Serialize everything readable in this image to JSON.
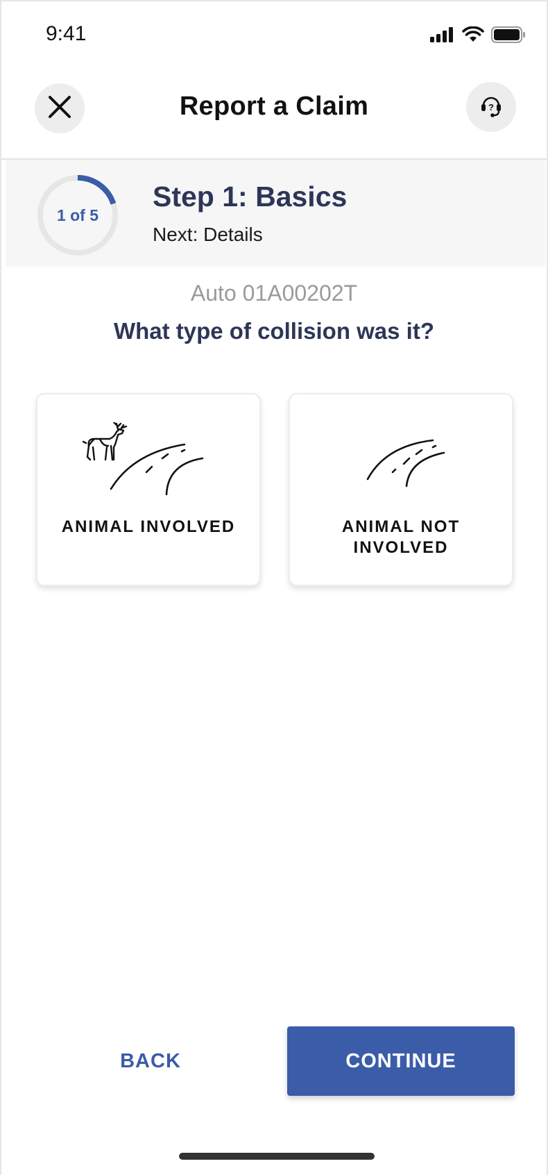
{
  "status_bar": {
    "time": "9:41"
  },
  "header": {
    "title": "Report a Claim",
    "close_icon": "close-icon",
    "help_icon": "support-agent-icon"
  },
  "step": {
    "progress_label": "1 of 5",
    "current": 1,
    "total": 5,
    "title": "Step 1: Basics",
    "next": "Next: Details"
  },
  "question": {
    "policy": "Auto 01A00202T",
    "text": "What type of collision was it?"
  },
  "options": [
    {
      "label": "ANIMAL INVOLVED",
      "icon": "deer-road-icon"
    },
    {
      "label": "ANIMAL NOT INVOLVED",
      "icon": "road-icon"
    }
  ],
  "footer": {
    "back_label": "BACK",
    "continue_label": "CONTINUE"
  },
  "colors": {
    "accent": "#3b5ca8",
    "heading": "#2d3656",
    "banner_bg": "#f6f6f7"
  }
}
